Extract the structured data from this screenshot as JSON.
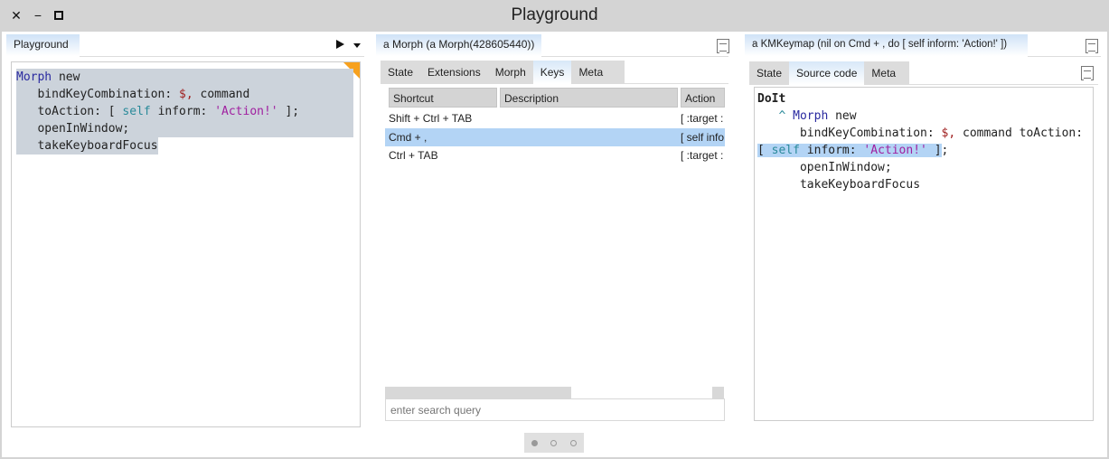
{
  "window": {
    "title": "Playground"
  },
  "left": {
    "tab": "Playground",
    "code": [
      "Morph",
      "new",
      "bindKeyCombination:",
      "$,",
      "command",
      "toAction:",
      "[",
      "self",
      "inform:",
      "'Action!'",
      "];",
      "openInWindow;",
      "takeKeyboardFocus"
    ]
  },
  "middle": {
    "tab": "a Morph (a Morph(428605440))",
    "tabs": [
      "State",
      "Extensions",
      "Morph",
      "Keys",
      "Meta"
    ],
    "columns": [
      "Shortcut",
      "Description",
      "Action"
    ],
    "rows": [
      {
        "shortcut": "Shift + Ctrl + TAB",
        "description": "",
        "action": "[ :target :"
      },
      {
        "shortcut": "Cmd + ,",
        "description": "",
        "action": "[ self info"
      },
      {
        "shortcut": "Ctrl + TAB",
        "description": "",
        "action": "[ :target :"
      }
    ],
    "search_placeholder": "enter search query"
  },
  "right": {
    "tab": "a KMKeymap (nil on Cmd + , do [ self inform: 'Action!' ])",
    "tabs": [
      "State",
      "Source code",
      "Meta"
    ],
    "code": {
      "header": "DoIt",
      "caret": "^",
      "l1a": "Morph",
      "l1b": " new",
      "l2a": "bindKeyCombination: ",
      "l2b": "$,",
      "l2c": " command toAction:",
      "l3a": "[ ",
      "l3b": "self",
      "l3c": " inform: ",
      "l3d": "'Action!'",
      "l3e": " ]",
      "l3f": ";",
      "l4": "openInWindow;",
      "l5": "takeKeyboardFocus"
    }
  },
  "colors": {
    "selection": "#ccd3db",
    "row_selected": "#b3d4f5",
    "keyword": "#2a2aa0",
    "string": "#a020a0",
    "self": "#2a8a9a"
  }
}
